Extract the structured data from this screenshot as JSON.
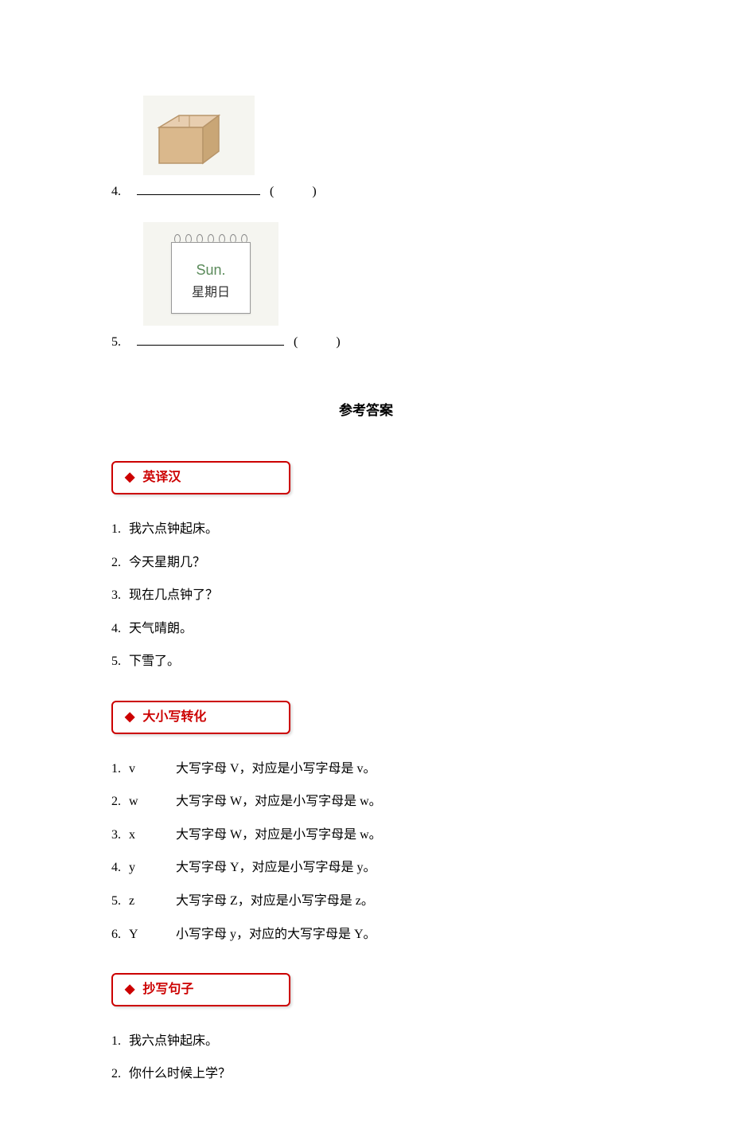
{
  "questions": {
    "q4": {
      "num": "4.",
      "paren_open": "(",
      "paren_close": ")"
    },
    "q5": {
      "num": "5.",
      "paren_open": "(",
      "paren_close": ")"
    }
  },
  "calendar": {
    "sun": "Sun.",
    "day": "星期日"
  },
  "answer_title": "参考答案",
  "sections": {
    "translate": {
      "diamond": "◆",
      "title": "英译汉",
      "items": [
        {
          "num": "1.",
          "text": "我六点钟起床。"
        },
        {
          "num": "2.",
          "text": "今天星期几？"
        },
        {
          "num": "3.",
          "text": "现在几点钟了？"
        },
        {
          "num": "4.",
          "text": "天气晴朗。"
        },
        {
          "num": "5.",
          "text": "下雪了。"
        }
      ]
    },
    "case": {
      "diamond": "◆",
      "title": "大小写转化",
      "items": [
        {
          "num": "1.",
          "letter": "v",
          "text": "大写字母 V，对应是小写字母是 v。"
        },
        {
          "num": "2.",
          "letter": "w",
          "text": "大写字母 W，对应是小写字母是 w。"
        },
        {
          "num": "3.",
          "letter": "x",
          "text": "大写字母 W，对应是小写字母是 w。"
        },
        {
          "num": "4.",
          "letter": "y",
          "text": "大写字母 Y，对应是小写字母是 y。"
        },
        {
          "num": "5.",
          "letter": "z",
          "text": "大写字母 Z，对应是小写字母是 z。"
        },
        {
          "num": "6.",
          "letter": "Y",
          "text": "小写字母 y，对应的大写字母是 Y。"
        }
      ]
    },
    "copy": {
      "diamond": "◆",
      "title": "抄写句子",
      "items": [
        {
          "num": "1.",
          "text": "我六点钟起床。"
        },
        {
          "num": "2.",
          "text": "你什么时候上学？"
        }
      ]
    }
  }
}
